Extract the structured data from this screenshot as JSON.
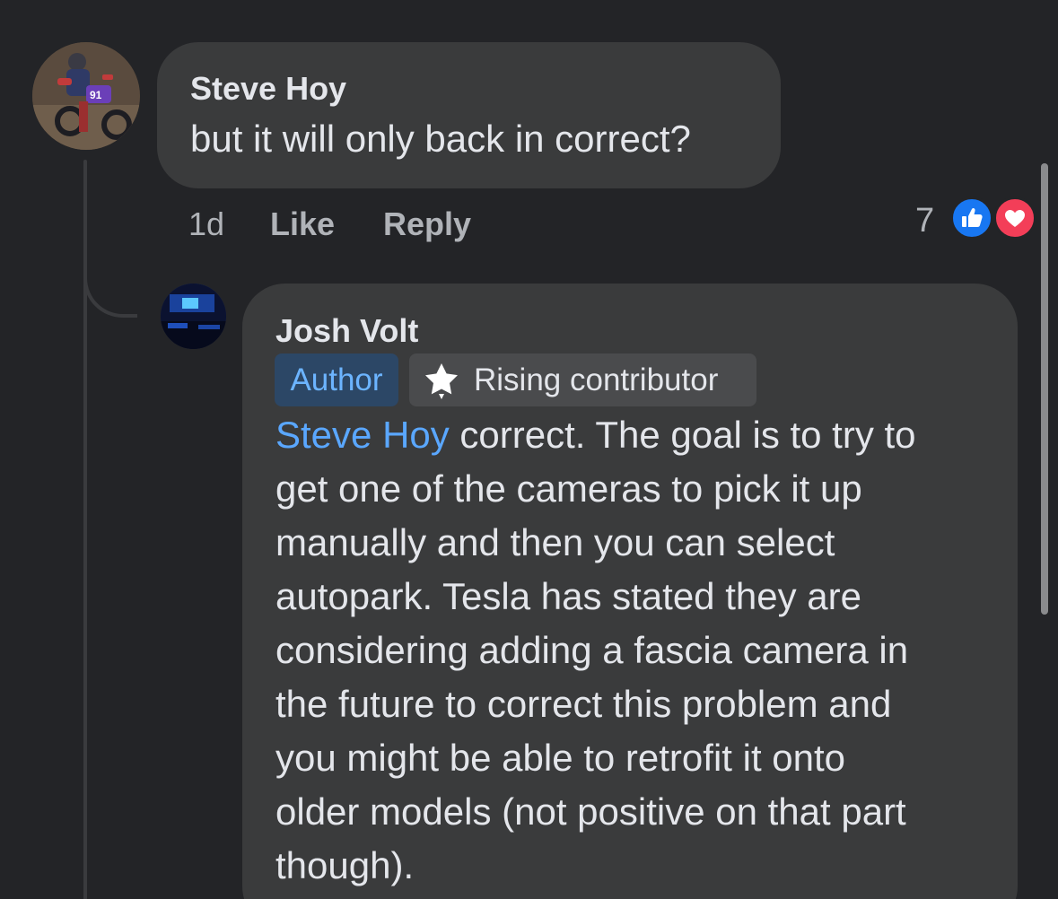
{
  "comment": {
    "author": "Steve Hoy",
    "text": "but it will only back in correct?",
    "time": "1d",
    "like_label": "Like",
    "reply_label": "Reply",
    "reaction_count": "7",
    "reactions": [
      "like-icon",
      "love-icon"
    ]
  },
  "reply": {
    "author": "Josh Volt",
    "badges": {
      "author": "Author",
      "contributor": "Rising contributor"
    },
    "mention": "Steve Hoy",
    "lines": [
      " correct. The goal is to try to",
      "get one of the cameras to pick it up",
      "manually and then you can select",
      "autopark. Tesla has stated they are",
      "considering adding a fascia camera in",
      "the future to correct this problem and",
      "you might be able to retrofit it onto",
      "older models (not positive on that part",
      "though)."
    ]
  },
  "colors": {
    "background": "#232427",
    "bubble": "#3a3b3c",
    "mention": "#5aa7ff",
    "like": "#1877f2",
    "love": "#f33e58"
  }
}
